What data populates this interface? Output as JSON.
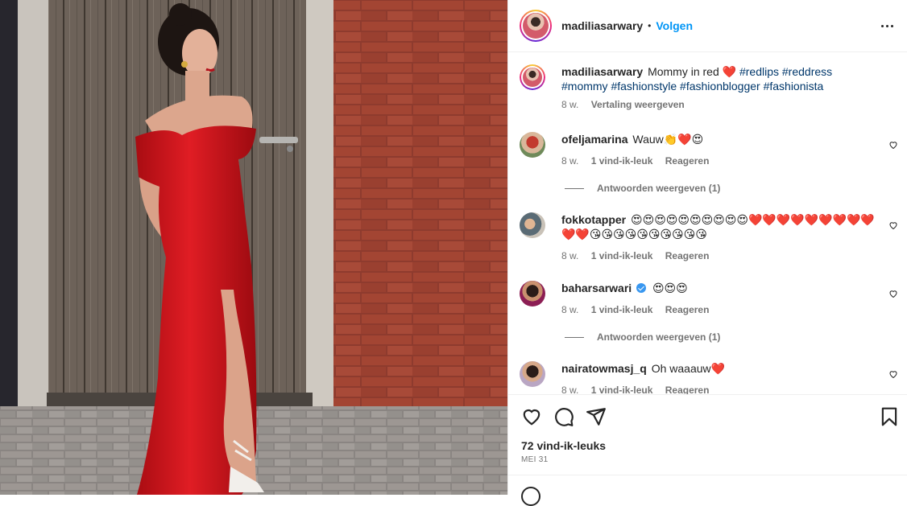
{
  "post": {
    "author": "madiliasarwary",
    "dot": "•",
    "follow_label": "Volgen",
    "more_icon": "more-horizontal-icon"
  },
  "caption": {
    "username": "madiliasarwary",
    "text": "Mommy in red ❤️",
    "hashtags_line1": "#redlips #reddress",
    "hashtags_line2": "#mommy #fashionstyle #fashionblogger #fashionista",
    "age": "8 w.",
    "translate_label": "Vertaling weergeven"
  },
  "comments": [
    {
      "username": "ofeljamarina",
      "text": "Wauw👏❤️😍",
      "age": "8 w.",
      "likes": "1 vind-ik-leuk",
      "reply_label": "Reageren",
      "verified": false,
      "replies_label": "Antwoorden weergeven (1)"
    },
    {
      "username": "fokkotapper",
      "text": "😍😍😍😍😍😍😍😍😍😍❤️❤️❤️❤️❤️❤️❤️❤️❤️❤️❤️😘😘😘😘😘😘😘😘😘😘",
      "age": "8 w.",
      "likes": "1 vind-ik-leuk",
      "reply_label": "Reageren",
      "verified": false
    },
    {
      "username": "baharsarwari",
      "text": "😍😍😍",
      "age": "8 w.",
      "likes": "1 vind-ik-leuk",
      "reply_label": "Reageren",
      "verified": true,
      "replies_label": "Antwoorden weergeven (1)"
    },
    {
      "username": "nairatowmasj_q",
      "text": "Oh waaauw❤️",
      "age": "8 w.",
      "likes": "1 vind-ik-leuk",
      "reply_label": "Reageren",
      "verified": false
    }
  ],
  "stats": {
    "likes": "72 vind-ik-leuks",
    "date": "MEI 31"
  },
  "icons": {
    "like": "heart-icon",
    "comment": "comment-icon",
    "share": "send-icon",
    "save": "bookmark-icon"
  },
  "colors": {
    "link": "#0095f6",
    "hashtag": "#00376b",
    "muted": "#737373",
    "text": "#262626",
    "dress": "#d8141b"
  }
}
